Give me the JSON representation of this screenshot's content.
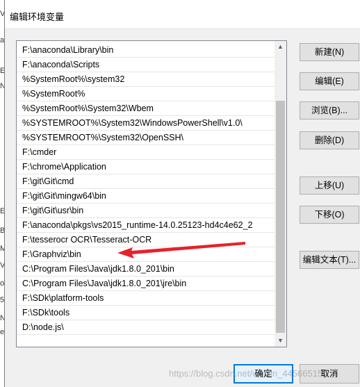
{
  "dialog": {
    "title": "编辑环境变量"
  },
  "background": {
    "glyphs": [
      "V",
      "a",
      "E",
      "N",
      "E",
      "B",
      "M",
      "V",
      "o",
      "5",
      "N",
      "e"
    ]
  },
  "paths": [
    "F:\\anaconda\\Library\\bin",
    "F:\\anaconda\\Scripts",
    "%SystemRoot%\\system32",
    "%SystemRoot%",
    "%SystemRoot%\\System32\\Wbem",
    "%SYSTEMROOT%\\System32\\WindowsPowerShell\\v1.0\\",
    "%SYSTEMROOT%\\System32\\OpenSSH\\",
    "F:\\cmder",
    "F:\\chrome\\Application",
    "F:\\git\\Git\\cmd",
    "F:\\git\\Git\\mingw64\\bin",
    "F:\\git\\Git\\usr\\bin",
    "F:\\anaconda\\pkgs\\vs2015_runtime-14.0.25123-hd4c4e62_2",
    "F:\\tesserocr OCR\\Tesseract-OCR",
    "F:\\Graphviz\\bin",
    "C:\\Program Files\\Java\\jdk1.8.0_201\\bin",
    "C:\\Program Files\\Java\\jdk1.8.0_201\\jre\\bin",
    "F:\\SDk\\platform-tools",
    "F:\\SDk\\tools",
    "D:\\node.js\\"
  ],
  "buttons": {
    "new": "新建(N)",
    "edit": "编辑(E)",
    "browse": "浏览(B)...",
    "delete": "删除(D)",
    "move_up": "上移(U)",
    "move_down": "下移(O)",
    "edit_text": "编辑文本(T)...",
    "ok": "确定",
    "cancel": "取消"
  },
  "watermark": "https://blog.csdn.net/weixin_44566515",
  "colors": {
    "arrow": "#e8202a",
    "focus_border": "#0078d7"
  },
  "icons": {
    "scroll_up": "▲",
    "scroll_down": "▼"
  }
}
